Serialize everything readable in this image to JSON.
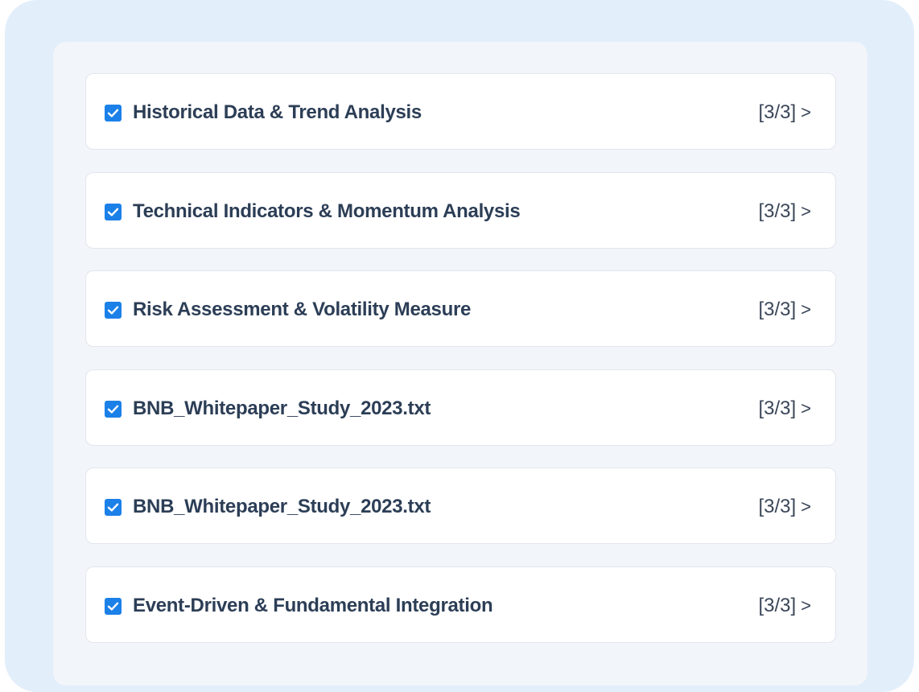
{
  "tasks": [
    {
      "label": "Historical Data & Trend Analysis",
      "checked": true,
      "progress": "[3/3]",
      "chevron": ">"
    },
    {
      "label": "Technical Indicators & Momentum Analysis",
      "checked": true,
      "progress": "[3/3]",
      "chevron": ">"
    },
    {
      "label": "Risk Assessment & Volatility Measure",
      "checked": true,
      "progress": "[3/3]",
      "chevron": ">"
    },
    {
      "label": "BNB_Whitepaper_Study_2023.txt",
      "checked": true,
      "progress": "[3/3]",
      "chevron": ">"
    },
    {
      "label": "BNB_Whitepaper_Study_2023.txt",
      "checked": true,
      "progress": "[3/3]",
      "chevron": ">"
    },
    {
      "label": "Event-Driven & Fundamental Integration",
      "checked": true,
      "progress": "[3/3]",
      "chevron": ">"
    }
  ],
  "colors": {
    "checkbox": "#1b80e8",
    "label": "#2c3e56",
    "outer_background": "#e3eefb",
    "panel_background": "#f2f5f9"
  },
  "icons": {
    "checkbox": "checkbox-checked-icon",
    "chevron": "chevron-right-icon"
  }
}
